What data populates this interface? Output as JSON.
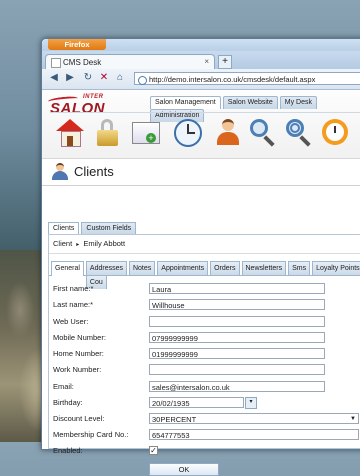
{
  "browser": {
    "app_button": "Firefox",
    "tab_title": "CMS Desk",
    "new_tab": "+",
    "close_tab": "×",
    "url": "http://demo.intersalon.co.uk/cmsdesk/default.aspx"
  },
  "logo": {
    "top": "INTER",
    "main": "SALON"
  },
  "module_tabs": [
    "Salon Management",
    "Salon Website",
    "My Desk",
    "Administration"
  ],
  "page_title": "Clients",
  "sub_tabs": [
    "Clients",
    "Custom Fields"
  ],
  "breadcrumb": {
    "root": "Client",
    "sep": "▸",
    "current": "Emily Abbott"
  },
  "form_tabs": [
    "General",
    "Addresses",
    "Notes",
    "Appointments",
    "Orders",
    "Newsletters",
    "Sms",
    "Loyalty Points",
    "Cou"
  ],
  "fields": {
    "first_name": {
      "label": "First name:*",
      "value": "Laura"
    },
    "last_name": {
      "label": "Last name:*",
      "value": "Willhouse"
    },
    "web_user": {
      "label": "Web User:",
      "value": ""
    },
    "mobile": {
      "label": "Mobile Number:",
      "value": "07999999999"
    },
    "home": {
      "label": "Home Number:",
      "value": "01999999999"
    },
    "work": {
      "label": "Work Number:",
      "value": ""
    },
    "email": {
      "label": "Email:",
      "value": "sales@intersalon.co.uk"
    },
    "birthday": {
      "label": "Birthday:",
      "value": "20/02/1935"
    },
    "discount": {
      "label": "Discount Level:",
      "value": "30PERCENT"
    },
    "membership": {
      "label": "Membership Card No.:",
      "value": "654777553"
    },
    "enabled": {
      "label": "Enabled:",
      "value": "✓"
    }
  },
  "ok_label": "OK",
  "icons": [
    "home-icon",
    "lock-icon",
    "screen-add-icon",
    "clock-icon",
    "person-icon",
    "magnifier-icon",
    "magnifier-zoom-icon",
    "alarm-clock-icon"
  ]
}
